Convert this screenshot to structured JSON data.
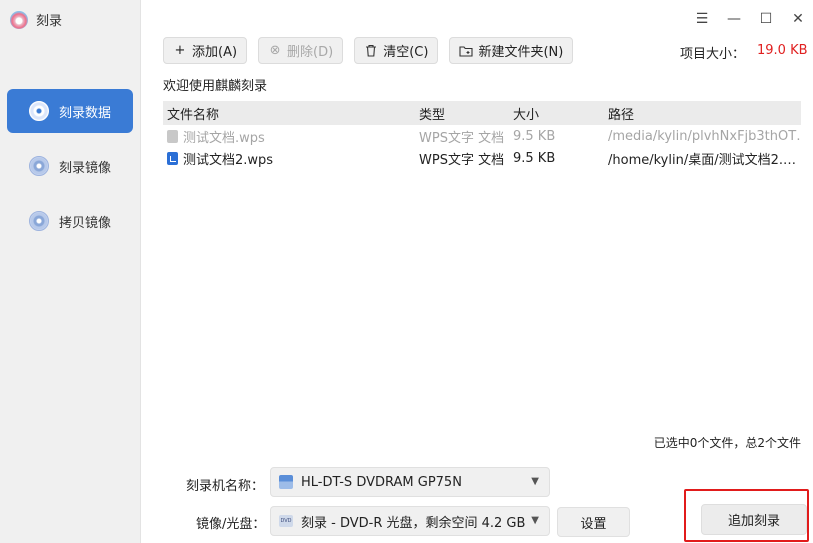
{
  "app": {
    "title": "刻录",
    "window_controls": [
      "menu-icon",
      "minimize-icon",
      "maximize-icon",
      "close-icon"
    ]
  },
  "sidebar": {
    "items": [
      {
        "label": "刻录数据",
        "icon": "disc-icon",
        "active": true
      },
      {
        "label": "刻录镜像",
        "icon": "disc-icon",
        "active": false
      },
      {
        "label": "拷贝镜像",
        "icon": "disc-icon",
        "active": false
      }
    ]
  },
  "toolbar": {
    "add_label": "添加(A)",
    "delete_label": "删除(D)",
    "clear_label": "清空(C)",
    "new_folder_label": "新建文件夹(N)"
  },
  "project_size": {
    "label": "项目大小：",
    "value": "19.0 KB",
    "value_color": "#e02020"
  },
  "welcome_text": "欢迎使用麒麟刻录",
  "table": {
    "headers": [
      "文件名称",
      "类型",
      "大小",
      "路径"
    ],
    "rows": [
      {
        "name": "测试文档.wps",
        "type": "WPS文字 文档",
        "size": "9.5 KB",
        "path": "/media/kylin/plvhNxFjb3thOT…",
        "dimmed": true
      },
      {
        "name": "测试文档2.wps",
        "type": "WPS文字 文档",
        "size": "9.5 KB",
        "path": "/home/kylin/桌面/测试文档2.…",
        "dimmed": false
      }
    ]
  },
  "selection_info": "已选中0个文件，总2个文件",
  "burner": {
    "label": "刻录机名称：",
    "value": "HL-DT-S DVDRAM GP75N"
  },
  "image_disc": {
    "label": "镜像/光盘：",
    "value": "刻录 - DVD-R 光盘，剩余空间 4.2 GB",
    "icon_text": "DVD"
  },
  "settings_label": "设置",
  "burn_button_label": "追加刻录",
  "colors": {
    "accent": "#3a7bd5",
    "highlight_border": "#e11b1b"
  }
}
